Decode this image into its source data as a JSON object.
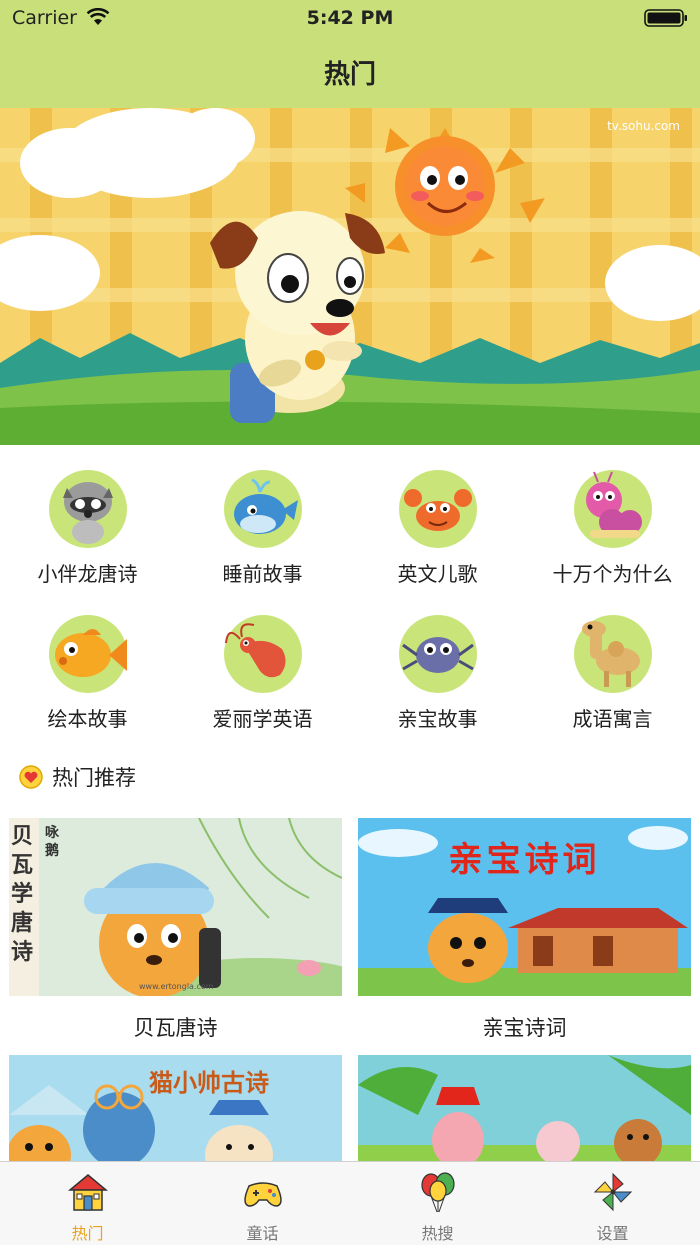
{
  "status_bar": {
    "carrier": "Carrier",
    "time": "5:42 PM"
  },
  "nav": {
    "title": "热门"
  },
  "banner": {
    "watermark": "tv.sohu.com"
  },
  "categories": [
    {
      "label": "小伴龙唐诗",
      "icon": "raccoon-icon"
    },
    {
      "label": "睡前故事",
      "icon": "whale-icon"
    },
    {
      "label": "英文儿歌",
      "icon": "crab-icon"
    },
    {
      "label": "十万个为什么",
      "icon": "caterpillar-icon"
    },
    {
      "label": "绘本故事",
      "icon": "goldfish-icon"
    },
    {
      "label": "爱丽学英语",
      "icon": "shrimp-icon"
    },
    {
      "label": "亲宝故事",
      "icon": "spider-icon"
    },
    {
      "label": "成语寓言",
      "icon": "camel-icon"
    }
  ],
  "section": {
    "title": "热门推荐",
    "icon": "heart-badge-icon"
  },
  "cards": [
    {
      "caption": "贝瓦唐诗",
      "thumb_text": "贝瓦学唐诗",
      "thumb_sub": "咏鹅",
      "thumb_url": "www.ertongla.com"
    },
    {
      "caption": "亲宝诗词",
      "thumb_text": "亲宝诗词"
    },
    {
      "caption": "",
      "thumb_text": "猫小帅古诗"
    },
    {
      "caption": "",
      "thumb_text": ""
    }
  ],
  "tabs": [
    {
      "label": "热门",
      "icon": "house-icon",
      "active": true
    },
    {
      "label": "童话",
      "icon": "gamepad-icon",
      "active": false
    },
    {
      "label": "热搜",
      "icon": "balloons-icon",
      "active": false
    },
    {
      "label": "设置",
      "icon": "pinwheel-icon",
      "active": false
    }
  ],
  "colors": {
    "nav": "#c9df7a",
    "tab_active": "#e8a21c",
    "tab_inactive": "#777777"
  }
}
